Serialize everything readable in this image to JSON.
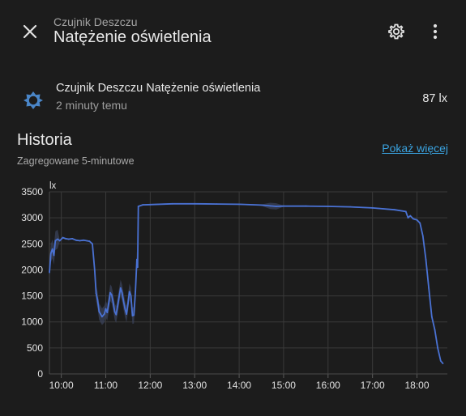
{
  "header": {
    "breadcrumb": "Czujnik Deszczu",
    "title": "Natężenie oświetlenia"
  },
  "entity": {
    "name": "Czujnik Deszczu Natężenie oświetlenia",
    "last_changed": "2 minuty temu",
    "value": "87 lx",
    "icon": "brightness-icon"
  },
  "history": {
    "title": "Historia",
    "aggregation": "Zagregowane 5-minutowe",
    "show_more": "Pokaż więcej"
  },
  "colors": {
    "background": "#1c1c1c",
    "line": "#4a72d4",
    "band": "#39415a",
    "link": "#3aa3e0",
    "icon": "#4a86c8"
  },
  "chart_data": {
    "type": "line",
    "ylabel": "lx",
    "ylim": [
      0,
      3500
    ],
    "yticks": [
      "0",
      "500",
      "1000",
      "1500",
      "2000",
      "2500",
      "3000",
      "3500"
    ],
    "xlim": [
      "09:44",
      "18:41"
    ],
    "xticks": [
      "10:00",
      "11:00",
      "12:00",
      "13:00",
      "14:00",
      "15:00",
      "16:00",
      "17:00",
      "18:00"
    ],
    "grid": true,
    "series": [
      {
        "points": [
          [
            "09:44",
            1950
          ],
          [
            "09:46",
            2320
          ],
          [
            "09:48",
            2400
          ],
          [
            "09:50",
            2280
          ],
          [
            "09:52",
            2560
          ],
          [
            "09:55",
            2590
          ],
          [
            "09:58",
            2560
          ],
          [
            "10:02",
            2620
          ],
          [
            "10:06",
            2600
          ],
          [
            "10:10",
            2590
          ],
          [
            "10:15",
            2600
          ],
          [
            "10:20",
            2570
          ],
          [
            "10:25",
            2560
          ],
          [
            "10:30",
            2570
          ],
          [
            "10:38",
            2550
          ],
          [
            "10:42",
            2500
          ],
          [
            "10:45",
            2000
          ],
          [
            "10:47",
            1550
          ],
          [
            "10:49",
            1420
          ],
          [
            "10:51",
            1200
          ],
          [
            "10:53",
            1150
          ],
          [
            "10:55",
            1100
          ],
          [
            "10:58",
            1150
          ],
          [
            "11:00",
            1250
          ],
          [
            "11:02",
            1180
          ],
          [
            "11:04",
            1350
          ],
          [
            "11:06",
            1560
          ],
          [
            "11:08",
            1520
          ],
          [
            "11:10",
            1380
          ],
          [
            "11:12",
            1200
          ],
          [
            "11:14",
            1140
          ],
          [
            "11:16",
            1300
          ],
          [
            "11:18",
            1480
          ],
          [
            "11:20",
            1650
          ],
          [
            "11:22",
            1560
          ],
          [
            "11:24",
            1400
          ],
          [
            "11:26",
            1250
          ],
          [
            "11:28",
            1150
          ],
          [
            "11:30",
            1350
          ],
          [
            "11:32",
            1580
          ],
          [
            "11:34",
            1500
          ],
          [
            "11:36",
            1120
          ],
          [
            "11:38",
            1130
          ],
          [
            "11:40",
            1580
          ],
          [
            "11:42",
            2200
          ],
          [
            "11:43",
            2050
          ],
          [
            "11:44",
            3220
          ],
          [
            "11:50",
            3250
          ],
          [
            "12:00",
            3255
          ],
          [
            "12:30",
            3270
          ],
          [
            "13:00",
            3270
          ],
          [
            "13:30",
            3265
          ],
          [
            "14:00",
            3260
          ],
          [
            "14:30",
            3245
          ],
          [
            "14:42",
            3230
          ],
          [
            "14:50",
            3220
          ],
          [
            "15:00",
            3225
          ],
          [
            "15:30",
            3225
          ],
          [
            "16:00",
            3220
          ],
          [
            "16:30",
            3210
          ],
          [
            "17:00",
            3190
          ],
          [
            "17:30",
            3155
          ],
          [
            "17:45",
            3120
          ],
          [
            "17:48",
            3000
          ],
          [
            "17:51",
            3040
          ],
          [
            "17:55",
            2980
          ],
          [
            "18:00",
            2960
          ],
          [
            "18:04",
            2900
          ],
          [
            "18:08",
            2650
          ],
          [
            "18:12",
            2200
          ],
          [
            "18:16",
            1650
          ],
          [
            "18:20",
            1100
          ],
          [
            "18:24",
            850
          ],
          [
            "18:28",
            500
          ],
          [
            "18:32",
            250
          ],
          [
            "18:35",
            200
          ]
        ]
      }
    ]
  }
}
